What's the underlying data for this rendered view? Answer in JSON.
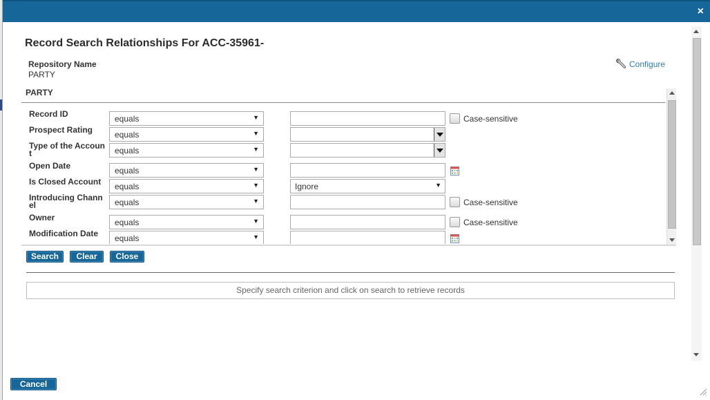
{
  "dialog": {
    "title": "Record Search Relationships For ACC-35961-",
    "repository_label": "Repository Name",
    "repository_value": "PARTY",
    "configure_label": "Configure",
    "section_title": "PARTY"
  },
  "fields": [
    {
      "label": "Record ID",
      "operator": "equals",
      "value_type": "text",
      "value": "",
      "case_sensitive": true
    },
    {
      "label": "Prospect Rating",
      "operator": "equals",
      "value_type": "combo",
      "value": ""
    },
    {
      "label": "Type of the Account",
      "operator": "equals",
      "value_type": "combo",
      "value": ""
    },
    {
      "label": "Open Date",
      "operator": "equals",
      "value_type": "date",
      "value": ""
    },
    {
      "label": "Is Closed Account",
      "operator": "equals",
      "value_type": "select",
      "value": "Ignore"
    },
    {
      "label": "Introducing Channel",
      "operator": "equals",
      "value_type": "text",
      "value": "",
      "case_sensitive": true
    },
    {
      "label": "Owner",
      "operator": "equals",
      "value_type": "text",
      "value": "",
      "case_sensitive": true
    },
    {
      "label": "Modification Date",
      "operator": "equals",
      "value_type": "date",
      "value": ""
    }
  ],
  "case_sensitive_label": "Case-sensitive",
  "buttons": {
    "search": "Search",
    "clear": "Clear",
    "close": "Close",
    "cancel": "Cancel"
  },
  "results_message": "Specify search criterion and click on search to retrieve records",
  "close_icon": "×",
  "colors": {
    "titlebar": "#16669a",
    "button": "#16669a",
    "link": "#2f7db8"
  }
}
